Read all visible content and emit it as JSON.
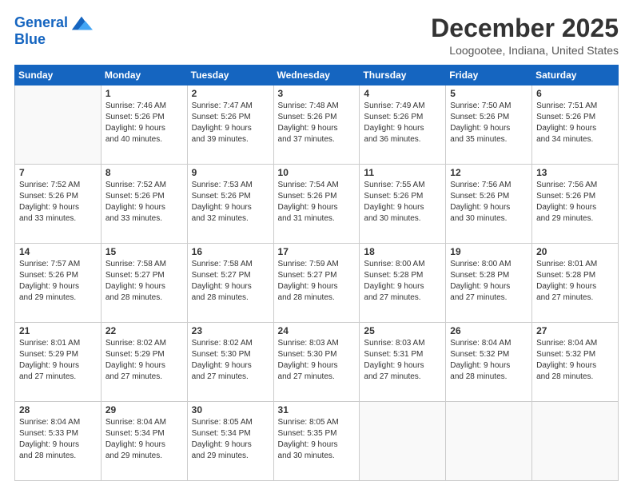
{
  "logo": {
    "line1": "General",
    "line2": "Blue"
  },
  "title": "December 2025",
  "location": "Loogootee, Indiana, United States",
  "days_header": [
    "Sunday",
    "Monday",
    "Tuesday",
    "Wednesday",
    "Thursday",
    "Friday",
    "Saturday"
  ],
  "weeks": [
    [
      {
        "num": "",
        "detail": ""
      },
      {
        "num": "1",
        "detail": "Sunrise: 7:46 AM\nSunset: 5:26 PM\nDaylight: 9 hours\nand 40 minutes."
      },
      {
        "num": "2",
        "detail": "Sunrise: 7:47 AM\nSunset: 5:26 PM\nDaylight: 9 hours\nand 39 minutes."
      },
      {
        "num": "3",
        "detail": "Sunrise: 7:48 AM\nSunset: 5:26 PM\nDaylight: 9 hours\nand 37 minutes."
      },
      {
        "num": "4",
        "detail": "Sunrise: 7:49 AM\nSunset: 5:26 PM\nDaylight: 9 hours\nand 36 minutes."
      },
      {
        "num": "5",
        "detail": "Sunrise: 7:50 AM\nSunset: 5:26 PM\nDaylight: 9 hours\nand 35 minutes."
      },
      {
        "num": "6",
        "detail": "Sunrise: 7:51 AM\nSunset: 5:26 PM\nDaylight: 9 hours\nand 34 minutes."
      }
    ],
    [
      {
        "num": "7",
        "detail": "Sunrise: 7:52 AM\nSunset: 5:26 PM\nDaylight: 9 hours\nand 33 minutes."
      },
      {
        "num": "8",
        "detail": "Sunrise: 7:52 AM\nSunset: 5:26 PM\nDaylight: 9 hours\nand 33 minutes."
      },
      {
        "num": "9",
        "detail": "Sunrise: 7:53 AM\nSunset: 5:26 PM\nDaylight: 9 hours\nand 32 minutes."
      },
      {
        "num": "10",
        "detail": "Sunrise: 7:54 AM\nSunset: 5:26 PM\nDaylight: 9 hours\nand 31 minutes."
      },
      {
        "num": "11",
        "detail": "Sunrise: 7:55 AM\nSunset: 5:26 PM\nDaylight: 9 hours\nand 30 minutes."
      },
      {
        "num": "12",
        "detail": "Sunrise: 7:56 AM\nSunset: 5:26 PM\nDaylight: 9 hours\nand 30 minutes."
      },
      {
        "num": "13",
        "detail": "Sunrise: 7:56 AM\nSunset: 5:26 PM\nDaylight: 9 hours\nand 29 minutes."
      }
    ],
    [
      {
        "num": "14",
        "detail": "Sunrise: 7:57 AM\nSunset: 5:26 PM\nDaylight: 9 hours\nand 29 minutes."
      },
      {
        "num": "15",
        "detail": "Sunrise: 7:58 AM\nSunset: 5:27 PM\nDaylight: 9 hours\nand 28 minutes."
      },
      {
        "num": "16",
        "detail": "Sunrise: 7:58 AM\nSunset: 5:27 PM\nDaylight: 9 hours\nand 28 minutes."
      },
      {
        "num": "17",
        "detail": "Sunrise: 7:59 AM\nSunset: 5:27 PM\nDaylight: 9 hours\nand 28 minutes."
      },
      {
        "num": "18",
        "detail": "Sunrise: 8:00 AM\nSunset: 5:28 PM\nDaylight: 9 hours\nand 27 minutes."
      },
      {
        "num": "19",
        "detail": "Sunrise: 8:00 AM\nSunset: 5:28 PM\nDaylight: 9 hours\nand 27 minutes."
      },
      {
        "num": "20",
        "detail": "Sunrise: 8:01 AM\nSunset: 5:28 PM\nDaylight: 9 hours\nand 27 minutes."
      }
    ],
    [
      {
        "num": "21",
        "detail": "Sunrise: 8:01 AM\nSunset: 5:29 PM\nDaylight: 9 hours\nand 27 minutes."
      },
      {
        "num": "22",
        "detail": "Sunrise: 8:02 AM\nSunset: 5:29 PM\nDaylight: 9 hours\nand 27 minutes."
      },
      {
        "num": "23",
        "detail": "Sunrise: 8:02 AM\nSunset: 5:30 PM\nDaylight: 9 hours\nand 27 minutes."
      },
      {
        "num": "24",
        "detail": "Sunrise: 8:03 AM\nSunset: 5:30 PM\nDaylight: 9 hours\nand 27 minutes."
      },
      {
        "num": "25",
        "detail": "Sunrise: 8:03 AM\nSunset: 5:31 PM\nDaylight: 9 hours\nand 27 minutes."
      },
      {
        "num": "26",
        "detail": "Sunrise: 8:04 AM\nSunset: 5:32 PM\nDaylight: 9 hours\nand 28 minutes."
      },
      {
        "num": "27",
        "detail": "Sunrise: 8:04 AM\nSunset: 5:32 PM\nDaylight: 9 hours\nand 28 minutes."
      }
    ],
    [
      {
        "num": "28",
        "detail": "Sunrise: 8:04 AM\nSunset: 5:33 PM\nDaylight: 9 hours\nand 28 minutes."
      },
      {
        "num": "29",
        "detail": "Sunrise: 8:04 AM\nSunset: 5:34 PM\nDaylight: 9 hours\nand 29 minutes."
      },
      {
        "num": "30",
        "detail": "Sunrise: 8:05 AM\nSunset: 5:34 PM\nDaylight: 9 hours\nand 29 minutes."
      },
      {
        "num": "31",
        "detail": "Sunrise: 8:05 AM\nSunset: 5:35 PM\nDaylight: 9 hours\nand 30 minutes."
      },
      {
        "num": "",
        "detail": ""
      },
      {
        "num": "",
        "detail": ""
      },
      {
        "num": "",
        "detail": ""
      }
    ]
  ]
}
